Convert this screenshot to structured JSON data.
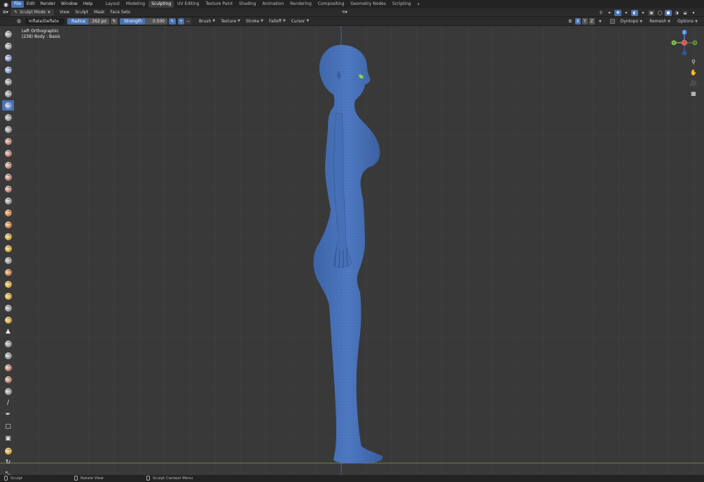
{
  "topbar": {
    "menus": [
      "File",
      "Edit",
      "Render",
      "Window",
      "Help"
    ],
    "active_menu": "File",
    "workspaces": [
      "Layout",
      "Modeling",
      "Sculpting",
      "UV Editing",
      "Texture Paint",
      "Shading",
      "Animation",
      "Rendering",
      "Compositing",
      "Geometry Nodes",
      "Scripting"
    ],
    "active_workspace": "Sculpting",
    "add_tab": "+"
  },
  "header": {
    "mode": "Sculpt Mode",
    "menus": [
      "View",
      "Sculpt",
      "Mask",
      "Face Sets"
    ]
  },
  "tool_settings": {
    "brush_name": "Inflate/Deflate",
    "radius_label": "Radius",
    "radius_value": "262 px",
    "strength_label": "Strength",
    "strength_value": "0.500",
    "plus": "+",
    "minus": "−",
    "dropdowns": [
      "Brush",
      "Texture",
      "Stroke",
      "Falloff",
      "Cursor"
    ],
    "axis_buttons": [
      "X",
      "Y",
      "Z"
    ],
    "dyntopo": "Dyntopo",
    "remesh": "Remesh",
    "options": "Options"
  },
  "viewport": {
    "view_name": "Left Orthographic",
    "object_info": "(238) Body : Basis",
    "grid_color": "#424242",
    "background": "#393939",
    "mesh_color": "#4a72b8"
  },
  "gizmo": {
    "z": "Z",
    "y": "Y",
    "x_color": "#e84a4a",
    "y_color": "#7fc64a",
    "z_color": "#4a8ae8"
  },
  "toolbar": {
    "tools": [
      {
        "name": "draw",
        "icon": "ball"
      },
      {
        "name": "draw-sharp",
        "icon": "ball"
      },
      {
        "name": "clay",
        "icon": "ball-blue"
      },
      {
        "name": "clay-strips",
        "icon": "ball-blue"
      },
      {
        "name": "clay-thumb",
        "icon": "ball"
      },
      {
        "name": "layer",
        "icon": "ball"
      },
      {
        "name": "inflate",
        "icon": "ball-blue",
        "active": true
      },
      {
        "name": "blob",
        "icon": "ball"
      },
      {
        "name": "crease",
        "icon": "ball"
      },
      {
        "name": "smooth",
        "icon": "ball-red"
      },
      {
        "name": "flatten",
        "icon": "ball-red"
      },
      {
        "name": "fill",
        "icon": "ball-red"
      },
      {
        "name": "scrape",
        "icon": "ball-red"
      },
      {
        "name": "multiplane-scrape",
        "icon": "ball-red"
      },
      {
        "name": "pinch",
        "icon": "ball"
      },
      {
        "name": "grab",
        "icon": "ball-orange"
      },
      {
        "name": "elastic-deform",
        "icon": "ball-orange"
      },
      {
        "name": "snake-hook",
        "icon": "ball-yellow"
      },
      {
        "name": "thumb",
        "icon": "ball-yellow"
      },
      {
        "name": "pose",
        "icon": "ball"
      },
      {
        "name": "nudge",
        "icon": "ball-orange"
      },
      {
        "name": "rotate",
        "icon": "ball-yellow"
      },
      {
        "name": "slide-relax",
        "icon": "ball-yellow"
      },
      {
        "name": "boundary",
        "icon": "ball"
      },
      {
        "name": "cloth",
        "icon": "ball-yellow"
      },
      {
        "name": "simplify",
        "icon": "glyph-tri"
      },
      {
        "name": "mask",
        "icon": "ball"
      },
      {
        "name": "draw-face-sets",
        "icon": "ball"
      },
      {
        "name": "multires-displacement-eraser",
        "icon": "ball-red"
      },
      {
        "name": "multires-displacement-smear",
        "icon": "ball-red"
      },
      {
        "name": "paint",
        "icon": "ball"
      },
      {
        "name": "smear",
        "icon": "glyph-brush"
      },
      {
        "name": "box-mask",
        "icon": "glyph-pen"
      },
      {
        "name": "box-hide",
        "icon": "glyph-box"
      },
      {
        "name": "box-face-set",
        "icon": "glyph-box2"
      },
      {
        "name": "box-trim",
        "icon": "ball-yellow"
      },
      {
        "name": "line-project",
        "icon": "glyph-rot"
      },
      {
        "name": "mesh-filter",
        "icon": "glyph-move"
      }
    ]
  },
  "status": {
    "left": "Sculpt",
    "middle": "Rotate View",
    "right": "Sculpt Context Menu"
  }
}
